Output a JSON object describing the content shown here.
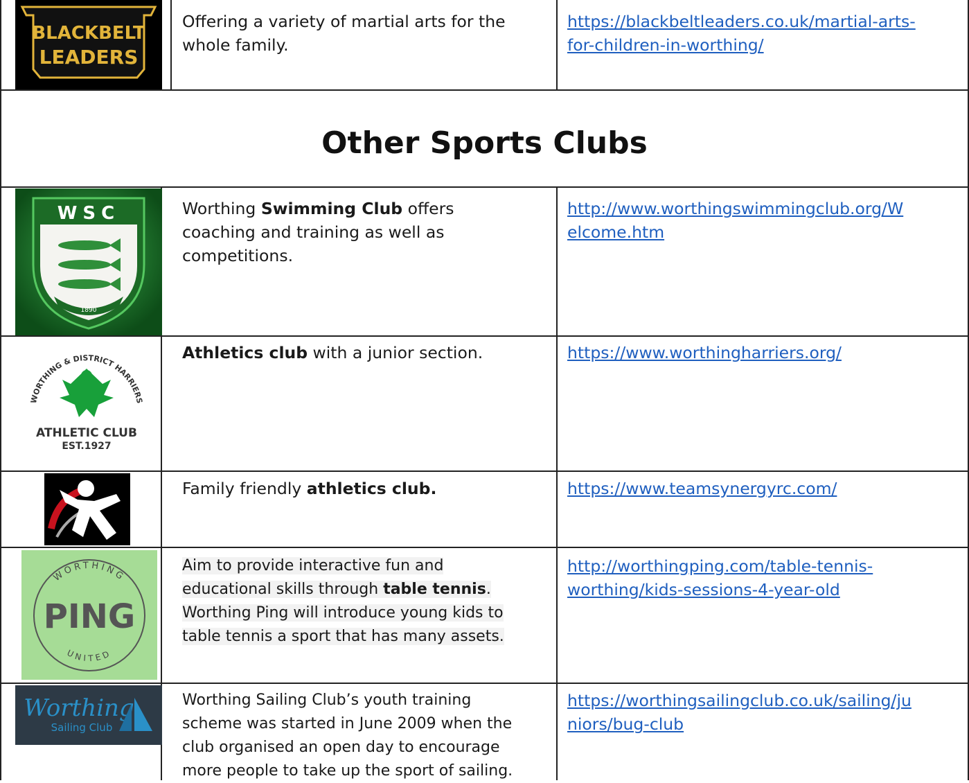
{
  "heading": "Other Sports Clubs",
  "rows": [
    {
      "logo_name": "blackbelt-leaders-logo",
      "logo_line1": "BLACKBELT",
      "logo_line2": "LEADERS",
      "desc_lines": [
        {
          "pre": "Offering a variety of martial arts for the",
          "bold": "",
          "post": ""
        },
        {
          "pre": "whole family.",
          "bold": "",
          "post": ""
        }
      ],
      "link_lines": [
        "https://blackbeltleaders.co.uk/martial-arts-",
        "for-children-in-worthing/"
      ]
    },
    {
      "logo_name": "worthing-swimming-club-logo",
      "logo_line1": "WSC",
      "logo_line2": "1890",
      "desc_lines": [
        {
          "pre": "Worthing ",
          "bold": "Swimming Club",
          "post": " offers"
        },
        {
          "pre": "coaching and training as well as",
          "bold": "",
          "post": ""
        },
        {
          "pre": "competitions.",
          "bold": "",
          "post": ""
        }
      ],
      "link_lines": [
        "http://www.worthingswimmingclub.org/W",
        "elcome.htm"
      ]
    },
    {
      "logo_name": "worthing-harriers-logo",
      "logo_line1": "WORTHING & DISTRICT HARRIERS",
      "logo_line2": "ATHLETIC CLUB",
      "logo_line3": "EST.1927",
      "desc_lines": [
        {
          "pre": "",
          "bold": "Athletics club",
          "post": " with a junior section."
        }
      ],
      "link_lines": [
        "https://www.worthingharriers.org/"
      ]
    },
    {
      "logo_name": "team-synergy-logo",
      "desc_lines": [
        {
          "pre": "Family friendly ",
          "bold": "athletics club.",
          "post": ""
        }
      ],
      "link_lines": [
        "https://www.teamsynergyrc.com/"
      ]
    },
    {
      "logo_name": "worthing-ping-logo",
      "logo_line1": "WORTHING",
      "logo_line2": "PING",
      "logo_line3": "UNITED",
      "desc_lines": [
        {
          "pre": "Aim to provide interactive fun and",
          "bold": "",
          "post": ""
        },
        {
          "pre": "educational skills through ",
          "bold": "table tennis",
          "post": "."
        },
        {
          "pre": "Worthing Ping will introduce young kids to",
          "bold": "",
          "post": ""
        },
        {
          "pre": "table tennis a sport that has many assets.",
          "bold": "",
          "post": ""
        }
      ],
      "link_lines": [
        "http://worthingping.com/table-tennis-",
        "worthing/kids-sessions-4-year-old"
      ]
    },
    {
      "logo_name": "worthing-sailing-club-logo",
      "logo_line1": "Worthing",
      "logo_line2": "Sailing Club",
      "desc_lines": [
        {
          "pre": "Worthing Sailing Club’s youth training",
          "bold": "",
          "post": ""
        },
        {
          "pre": "scheme was started in June 2009 when the",
          "bold": "",
          "post": ""
        },
        {
          "pre": "club organised an open day to encourage",
          "bold": "",
          "post": ""
        },
        {
          "pre": "more people to take up the sport of sailing.",
          "bold": "",
          "post": ""
        }
      ],
      "link_lines": [
        "https://worthingsailingclub.co.uk/sailing/ju",
        "niors/bug-club"
      ]
    }
  ],
  "colors": {
    "link": "#1f5fbf",
    "swim_green": "#1f7a2a",
    "harriers_green": "#18a03a",
    "ping_bg": "#a6dc96",
    "sailing_bg": "#2d3a46",
    "sailing_blue": "#2a90c8",
    "blackbelt_gold": "#e2b43a"
  }
}
